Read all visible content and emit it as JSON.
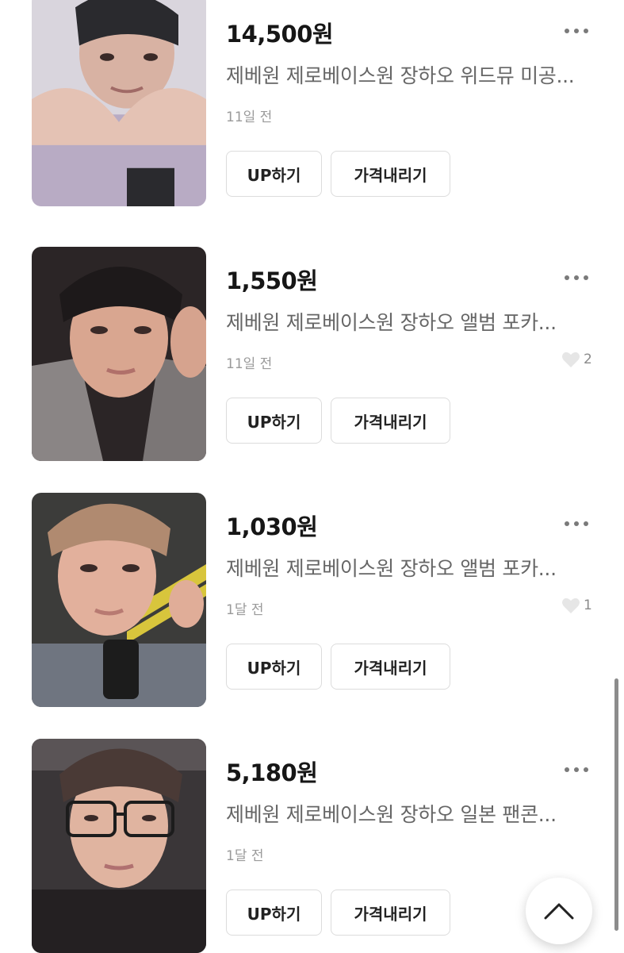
{
  "listings": [
    {
      "price": "14,500원",
      "title": "제베원 제로베이스원 장하오 위드뮤 미공...",
      "time": "11일 전",
      "likes": "",
      "up_label": "UP하기",
      "price_down_label": "가격내리기"
    },
    {
      "price": "1,550원",
      "title": "제베원 제로베이스원 장하오 앨범 포카...",
      "time": "11일 전",
      "likes": "2",
      "up_label": "UP하기",
      "price_down_label": "가격내리기"
    },
    {
      "price": "1,030원",
      "title": "제베원 제로베이스원 장하오 앨범 포카...",
      "time": "1달 전",
      "likes": "1",
      "up_label": "UP하기",
      "price_down_label": "가격내리기"
    },
    {
      "price": "5,180원",
      "title": "제베원 제로베이스원 장하오 일본 팬콘...",
      "time": "1달 전",
      "likes": "",
      "up_label": "UP하기",
      "price_down_label": "가격내리기"
    }
  ],
  "icons": {
    "more": "more-dots-icon",
    "heart": "heart-icon",
    "scroll_top": "chevron-up-icon"
  }
}
